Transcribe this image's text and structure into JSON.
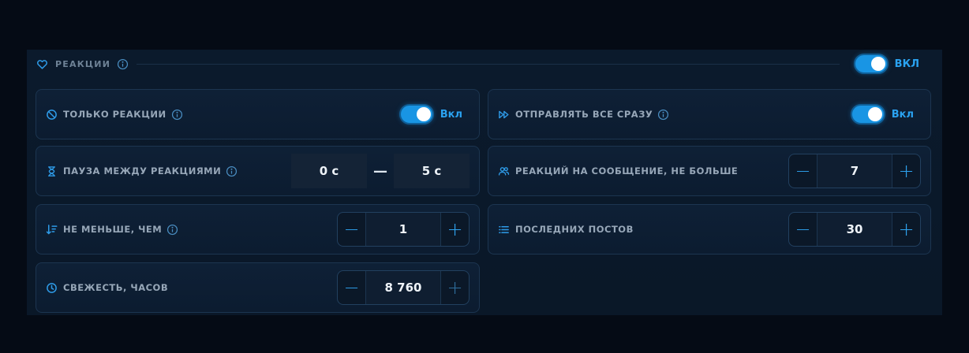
{
  "section": {
    "title": "РЕАКЦИИ",
    "toggle_label": "ВКЛ",
    "enabled": true
  },
  "cards": {
    "only_reactions": {
      "label": "ТОЛЬКО РЕАКЦИИ",
      "toggle_label": "Вкл",
      "enabled": true
    },
    "send_all_at_once": {
      "label": "ОТПРАВЛЯТЬ ВСЕ СРАЗУ",
      "toggle_label": "Вкл",
      "enabled": true
    },
    "pause": {
      "label": "ПАУЗА МЕЖДУ РЕАКЦИЯМИ",
      "from": "0 с",
      "separator": "—",
      "to": "5 с"
    },
    "reactions_per_message": {
      "label": "РЕАКЦИЙ НА СООБЩЕНИЕ, НЕ БОЛЬШЕ",
      "value": "7"
    },
    "not_less_than": {
      "label": "НЕ МЕНЬШЕ, ЧЕМ",
      "value": "1"
    },
    "last_posts": {
      "label": "ПОСЛЕДНИХ ПОСТОВ",
      "value": "30"
    },
    "freshness": {
      "label": "СВЕЖЕСТЬ, ЧАСОВ",
      "value": "8 760"
    }
  },
  "stepper": {
    "minus": "−",
    "plus": "+"
  },
  "icons": {
    "section": "heart-icon",
    "only_reactions": "ban-icon",
    "send_all_at_once": "fast-forward-icon",
    "pause": "hourglass-icon",
    "reactions_per_message": "users-icon",
    "not_less_than": "sort-desc-icon",
    "last_posts": "list-icon",
    "freshness": "clock-icon",
    "info": "info-icon"
  },
  "colors": {
    "accent": "#1995e4",
    "accent_text": "#2aa2f0",
    "label": "#97a7b8",
    "background": "#050b15",
    "panel": "#0b1a2c"
  }
}
